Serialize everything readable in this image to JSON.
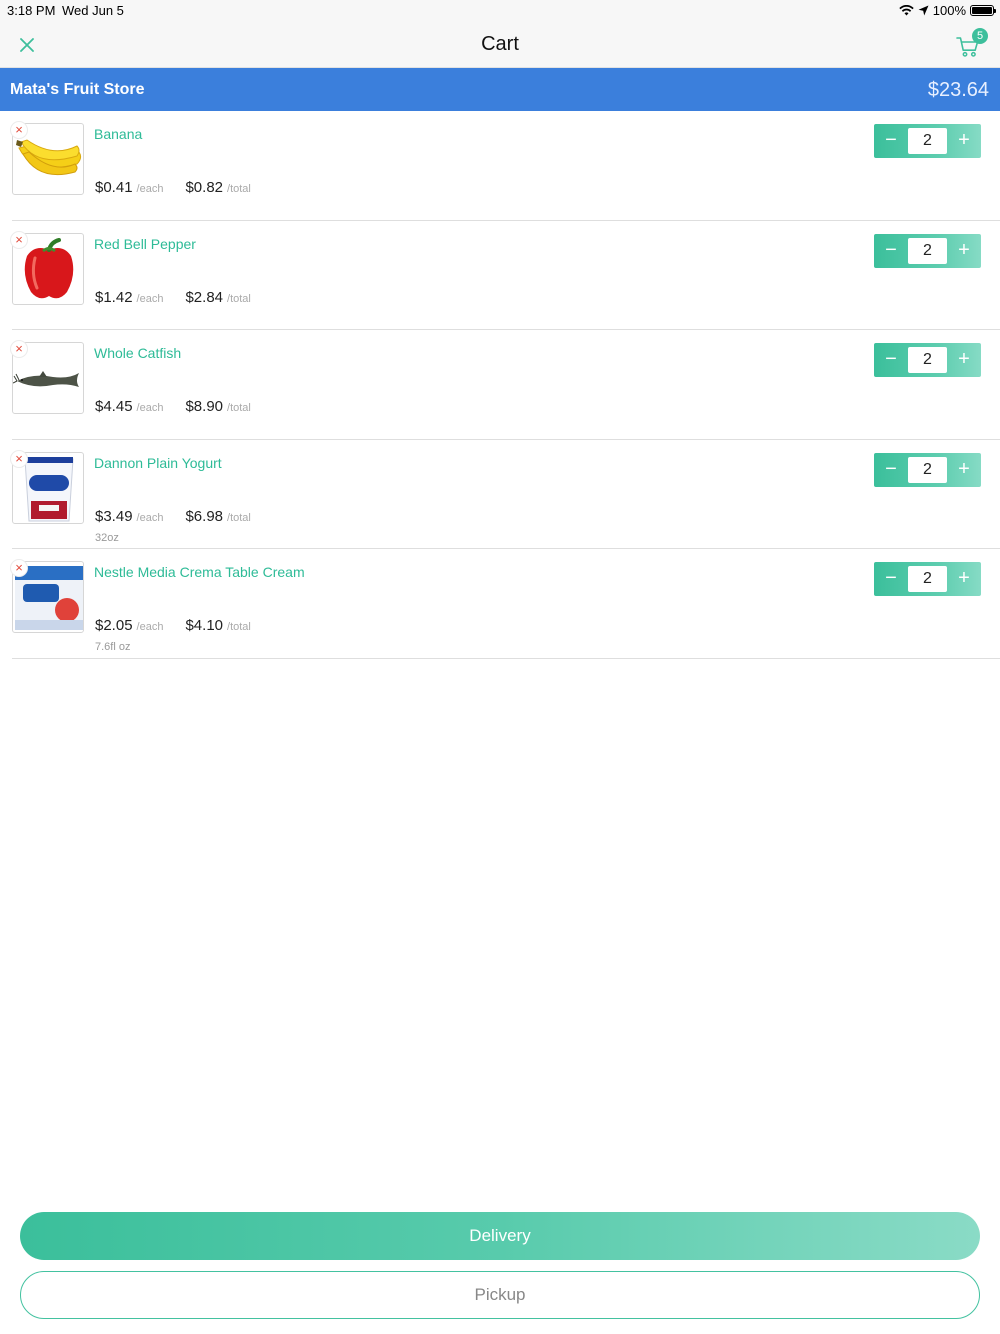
{
  "status": {
    "time": "3:18 PM",
    "date": "Wed Jun 5",
    "battery": "100%"
  },
  "nav": {
    "title": "Cart",
    "cart_count": "5",
    "accent": "#3dbf9c"
  },
  "store": {
    "name": "Mata's Fruit Store",
    "total": "$23.64",
    "color": "#3b7fdc"
  },
  "items": [
    {
      "name": "Banana",
      "each": "$0.41",
      "each_unit": "/each",
      "total": "$0.82",
      "total_unit": "/total",
      "size": "",
      "qty": "2"
    },
    {
      "name": "Red Bell Pepper",
      "each": "$1.42",
      "each_unit": "/each",
      "total": "$2.84",
      "total_unit": "/total",
      "size": "",
      "qty": "2"
    },
    {
      "name": "Whole Catfish",
      "each": "$4.45",
      "each_unit": "/each",
      "total": "$8.90",
      "total_unit": "/total",
      "size": "",
      "qty": "2"
    },
    {
      "name": "Dannon Plain Yogurt",
      "each": "$3.49",
      "each_unit": "/each",
      "total": "$6.98",
      "total_unit": "/total",
      "size": "32oz",
      "qty": "2"
    },
    {
      "name": "Nestle Media Crema Table Cream",
      "each": "$2.05",
      "each_unit": "/each",
      "total": "$4.10",
      "total_unit": "/total",
      "size": "7.6fl oz",
      "qty": "2"
    }
  ],
  "stepper": {
    "minus": "−",
    "plus": "+"
  },
  "remove_icon": "×",
  "actions": {
    "delivery": "Delivery",
    "pickup": "Pickup"
  }
}
